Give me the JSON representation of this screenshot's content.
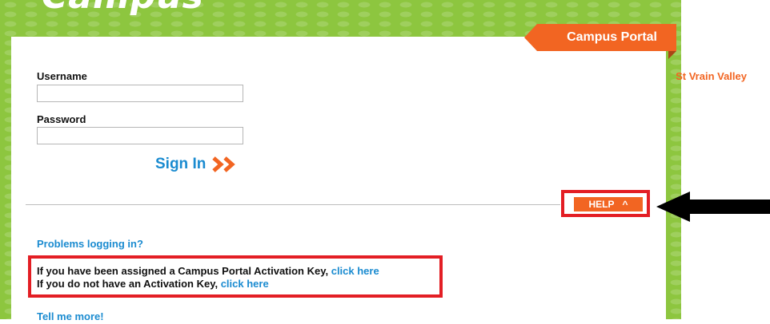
{
  "logo": {
    "text": "Campus"
  },
  "portal": {
    "tab_label": "Campus Portal",
    "district": "St Vrain Valley"
  },
  "form": {
    "username_label": "Username",
    "username_value": "",
    "password_label": "Password",
    "password_value": "",
    "sign_in_label": "Sign In"
  },
  "help": {
    "label": "HELP",
    "chevron": "^"
  },
  "links": {
    "problems": "Problems logging in?",
    "activation_assigned_text": "If you have been assigned a Campus Portal Activation Key, ",
    "activation_assigned_link": "click here",
    "activation_none_text": "If you do not have an Activation Key, ",
    "activation_none_link": "click here",
    "tell_more": "Tell me more!"
  },
  "colors": {
    "green": "#8dc63f",
    "orange": "#f26522",
    "link_blue": "#1a8bd0",
    "highlight_red": "#e31e24"
  }
}
